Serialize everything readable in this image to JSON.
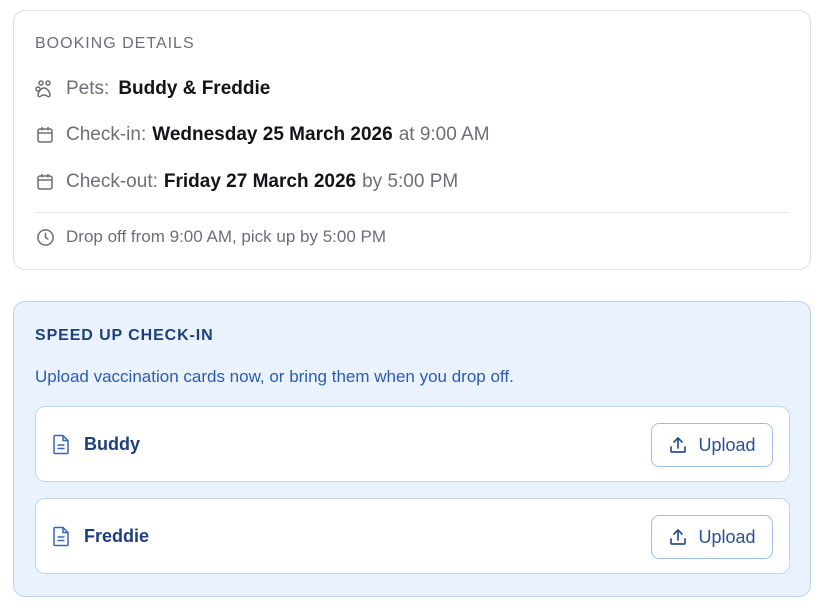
{
  "booking": {
    "title": "BOOKING DETAILS",
    "pets_label": "Pets:",
    "pets_value": "Buddy & Freddie",
    "checkin_label": "Check-in:",
    "checkin_date": "Wednesday 25 March 2026",
    "checkin_time": "at 9:00 AM",
    "checkout_label": "Check-out:",
    "checkout_date": "Friday 27 March 2026",
    "checkout_time": "by 5:00 PM",
    "dropoff_note": "Drop off from 9:00 AM, pick up by 5:00 PM",
    "icons": [
      "paw-icon",
      "calendar-icon",
      "calendar-icon",
      "clock-icon"
    ]
  },
  "speedup": {
    "title": "SPEED UP CHECK-IN",
    "subtitle": "Upload vaccination cards now, or bring them when you drop off.",
    "pets": [
      {
        "name": "Buddy",
        "button_label": "Upload"
      },
      {
        "name": "Freddie",
        "button_label": "Upload"
      }
    ],
    "icons": [
      "document-icon",
      "upload-icon"
    ]
  },
  "colors": {
    "accent": "#2b5bb8",
    "accent_dark": "#1e3f7e",
    "panel_bg": "#eaf3fd",
    "muted_text": "#6b6f76"
  }
}
